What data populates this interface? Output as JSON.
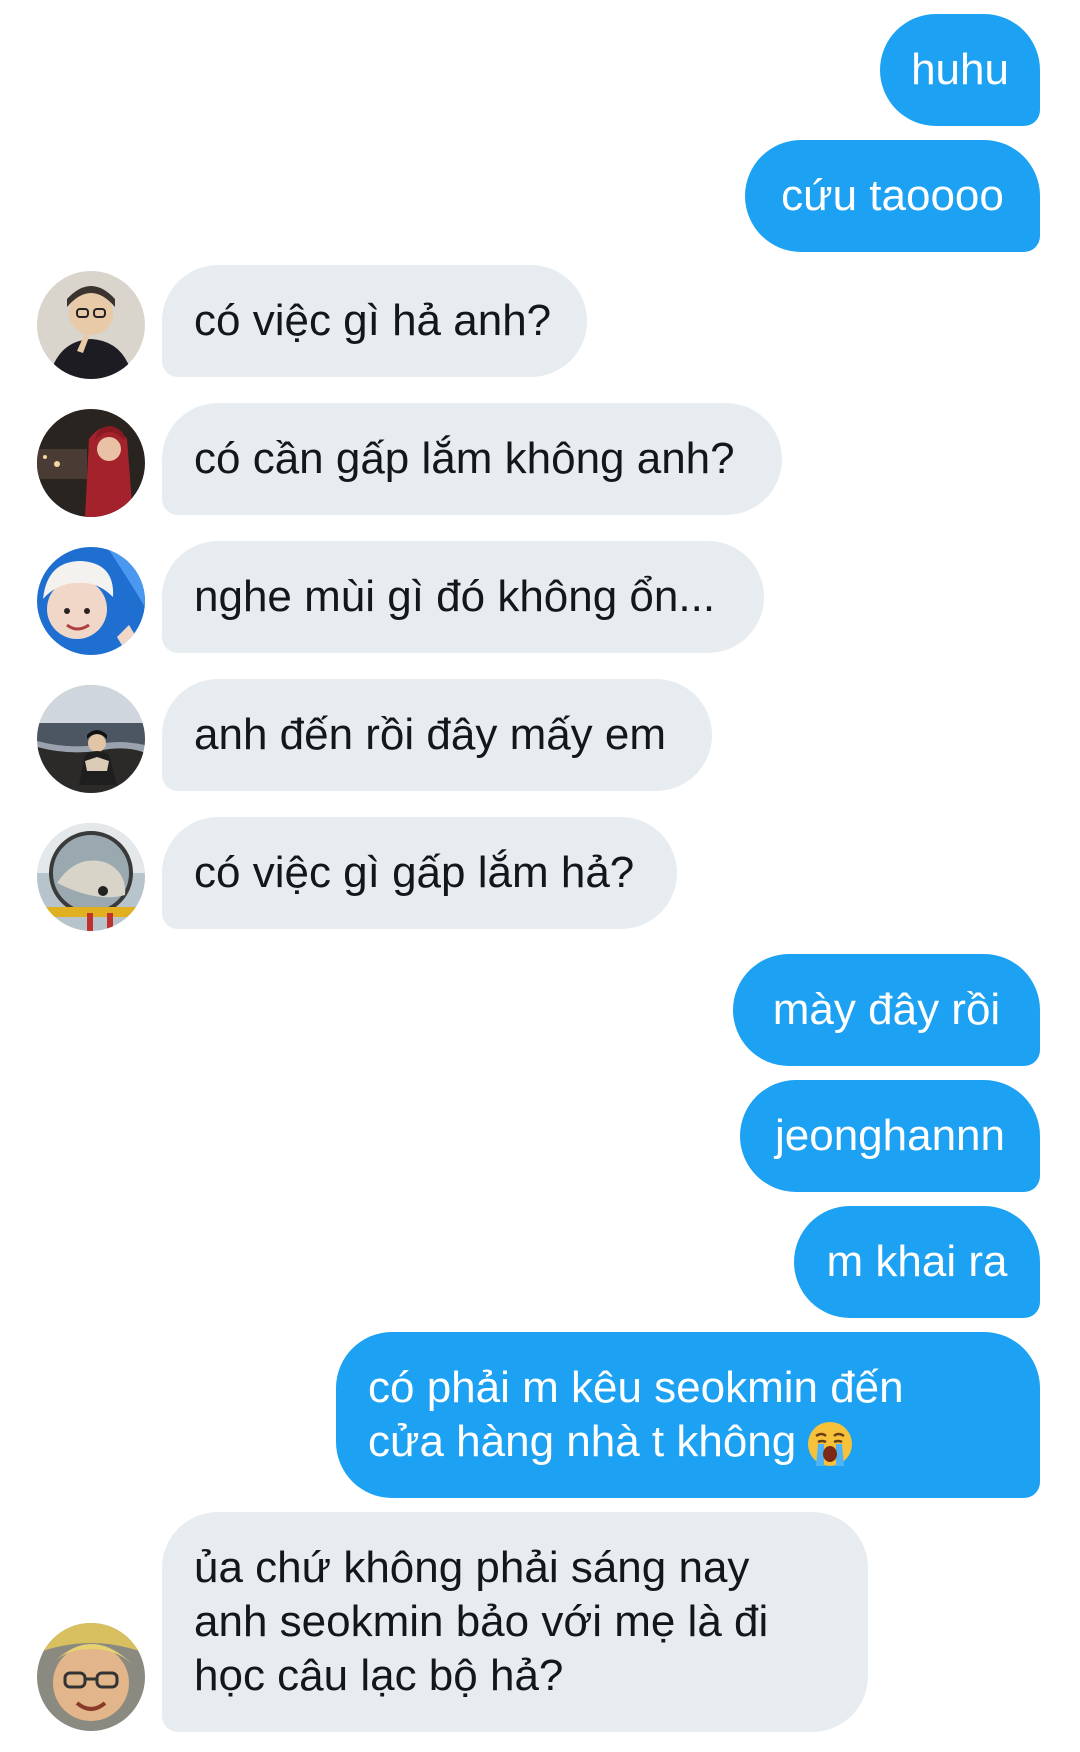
{
  "colors": {
    "outgoing_bubble": "#1da1f2",
    "incoming_bubble": "#e6ecf0",
    "outgoing_text": "#ffffff",
    "incoming_text": "#14171a"
  },
  "messages": [
    {
      "direction": "outgoing",
      "text": "huhu"
    },
    {
      "direction": "outgoing",
      "text": "cứu taoooo"
    },
    {
      "direction": "incoming",
      "avatar": "avatar-1",
      "text": "có việc gì hả anh?"
    },
    {
      "direction": "incoming",
      "avatar": "avatar-2",
      "text": "có cần gấp lắm không anh?"
    },
    {
      "direction": "incoming",
      "avatar": "avatar-3",
      "text": "nghe mùi gì đó không ổn..."
    },
    {
      "direction": "incoming",
      "avatar": "avatar-4",
      "text": "anh đến rồi đây mấy em"
    },
    {
      "direction": "incoming",
      "avatar": "avatar-5",
      "text": "có việc gì gấp lắm hả?"
    },
    {
      "direction": "outgoing",
      "text": "mày đây rồi"
    },
    {
      "direction": "outgoing",
      "text": "jeonghannn"
    },
    {
      "direction": "outgoing",
      "text": "m khai ra"
    },
    {
      "direction": "outgoing",
      "text": "có phải m kêu seokmin đến cửa hàng nhà t không",
      "emoji": "loudly-crying-face-icon"
    },
    {
      "direction": "incoming",
      "avatar": "avatar-6",
      "text": "ủa chứ không phải sáng nay anh seokmin bảo với mẹ là đi học câu lạc bộ hả?"
    }
  ]
}
